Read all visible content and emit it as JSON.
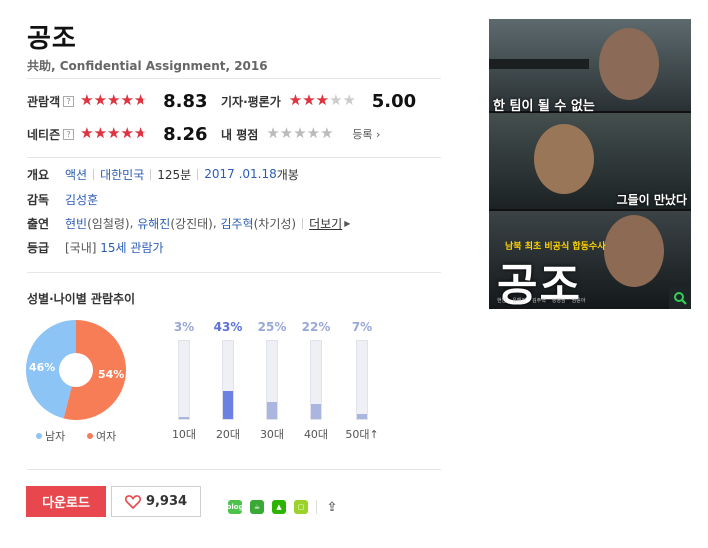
{
  "movie": {
    "title": "공조",
    "subtitle": "共助, Confidential Assignment, 2016"
  },
  "ratings": {
    "audience": {
      "label": "관람객",
      "help": "?",
      "score": "8.83",
      "stars_fraction": 0.8
    },
    "critic": {
      "label": "기자·평론가",
      "score": "5.00",
      "stars_fraction": 0.5
    },
    "netizen": {
      "label": "네티즌",
      "help": "?",
      "score": "8.26",
      "stars_fraction": 0.8
    },
    "mine": {
      "label": "내 평점",
      "register_label": "등록",
      "stars_fraction": 0
    }
  },
  "info": {
    "overview": {
      "key": "개요",
      "genre": "액션",
      "country": "대한민국",
      "runtime": "125분",
      "release_date": "2017 .01.18",
      "release_suffix": "개봉"
    },
    "director": {
      "key": "감독",
      "name": "김성훈"
    },
    "cast": {
      "key": "출연",
      "members": [
        {
          "name": "현빈",
          "role": "(임철령)"
        },
        {
          "name": "유해진",
          "role": "(강진태)"
        },
        {
          "name": "김주혁",
          "role": "(차기성)"
        }
      ],
      "more_label": "더보기"
    },
    "grade": {
      "key": "등급",
      "prefix": "[국내]",
      "value": "15세 관람가"
    }
  },
  "demographics": {
    "title": "성별·나이별 관람추이",
    "gender": {
      "male_label": "남자",
      "female_label": "여자",
      "male_pct": 46,
      "female_pct": 54,
      "male_text": "46%",
      "female_text": "54%",
      "male_color": "#8cc4f5",
      "female_color": "#f77d56"
    },
    "age": [
      {
        "label": "10대",
        "pct_text": "3%",
        "value": 3
      },
      {
        "label": "20대",
        "pct_text": "43%",
        "value": 43
      },
      {
        "label": "30대",
        "pct_text": "25%",
        "value": 25
      },
      {
        "label": "40대",
        "pct_text": "22%",
        "value": 22
      },
      {
        "label": "50대↑",
        "pct_text": "7%",
        "value": 7
      }
    ]
  },
  "actions": {
    "download_label": "다운로드",
    "like_count": "9,934",
    "share_icons": [
      "blog-icon",
      "cafe-icon",
      "me-icon",
      "memo-icon",
      "share-icon"
    ]
  },
  "poster": {
    "tagline_top": "한 팀이 될 수 없는",
    "tagline_mid": "그들이 만났다",
    "tagline_small": "남북 최초 비공식 합동수사",
    "title": "공조",
    "credits": [
      "현빈",
      "유해진",
      "김주혁",
      "장영남",
      "임윤아"
    ],
    "accent_color": "#ffd400"
  }
}
